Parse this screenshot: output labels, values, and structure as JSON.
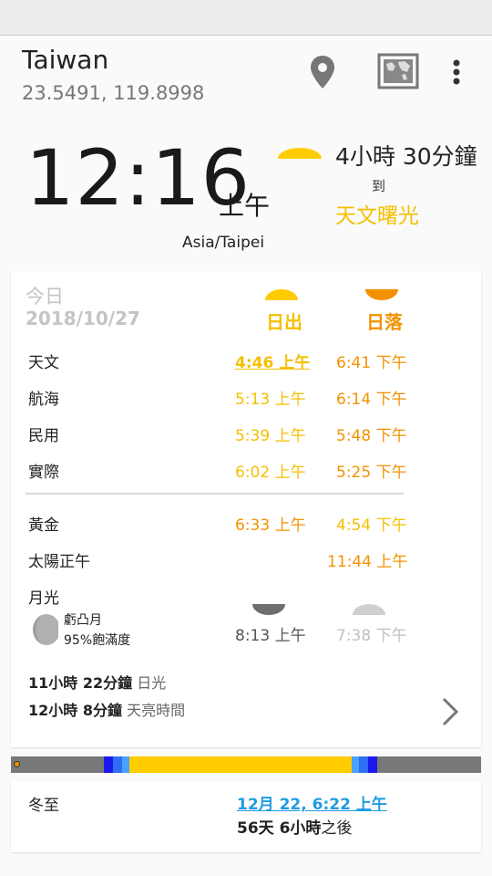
{
  "toolbar": {
    "location_name": "Taiwan",
    "coordinates": "23.5491, 119.8998",
    "icons": [
      "location-pin-icon",
      "map-icon",
      "more-vert-icon"
    ]
  },
  "clock": {
    "time": "12:16",
    "ampm": "上午",
    "timezone": "Asia/Taipei"
  },
  "next_event": {
    "duration": "4小時 30分鐘",
    "to": "到",
    "event": "天文曙光"
  },
  "day": {
    "label": "今日",
    "date": "2018/10/27",
    "sunrise_header": "日出",
    "sunset_header": "日落",
    "rows": [
      {
        "label": "天文",
        "rise": "4:46 上午",
        "set": "6:41 下午"
      },
      {
        "label": "航海",
        "rise": "5:13 上午",
        "set": "6:14 下午"
      },
      {
        "label": "民用",
        "rise": "5:39 上午",
        "set": "5:48 下午"
      },
      {
        "label": "實際",
        "rise": "6:02 上午",
        "set": "5:25 下午"
      }
    ],
    "golden": {
      "label": "黃金",
      "morning": "6:33 上午",
      "evening": "4:54 下午"
    },
    "noon": {
      "label": "太陽正午",
      "time": "11:44 上午"
    },
    "moon": {
      "label": "月光",
      "phase": "虧凸月",
      "illumination": "95%飽滿度",
      "rise": "8:13 上午",
      "set": "7:38 下午"
    },
    "daylight": {
      "value": "11小時 22分鐘",
      "label": "日光"
    },
    "twilight": {
      "value": "12小時 8分鐘",
      "label": "天亮時間"
    }
  },
  "season": {
    "label": "冬至",
    "date": "12月 22, 6:22 上午",
    "until_value": "56天 6小時",
    "until_suffix": "之後"
  },
  "colors": {
    "sunrise": "#f4c000",
    "sunset": "#f39200",
    "link": "#1e9be3",
    "night": "#787878",
    "astro": "#1a1aee",
    "civil": "#4aa2ff",
    "day": "#ffcc00"
  }
}
